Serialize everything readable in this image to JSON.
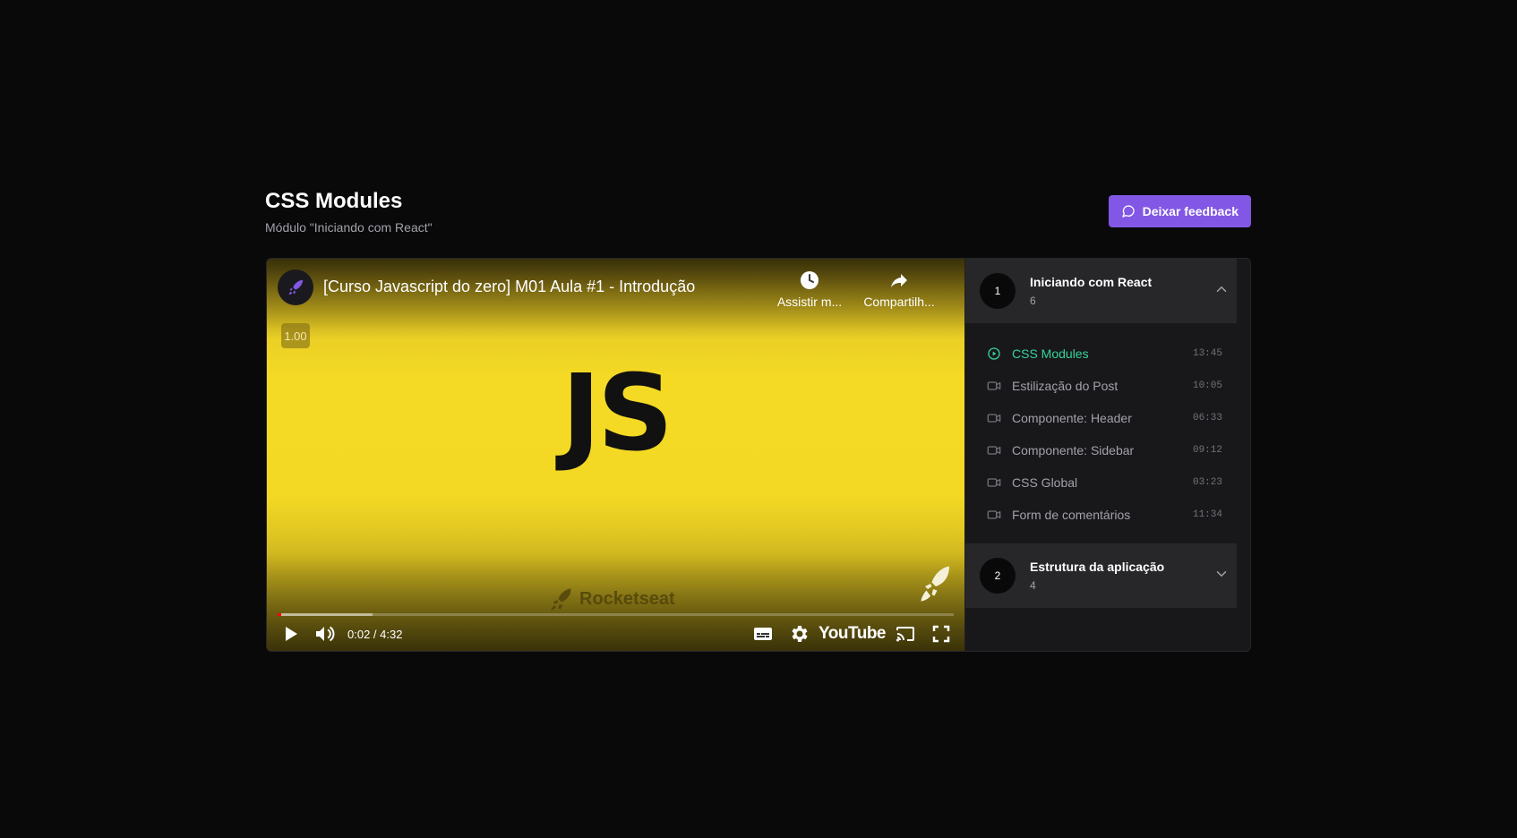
{
  "header": {
    "title": "CSS Modules",
    "subtitle": "Módulo \"Iniciando com React\"",
    "feedback_label": "Deixar feedback"
  },
  "video": {
    "title": "[Curso Javascript do zero] M01 Aula #1 - Introdução",
    "watch_later_label": "Assistir m...",
    "share_label": "Compartilh...",
    "speed": "1.00",
    "logo_text": "JS",
    "brand_text": "Rocketseat",
    "time": "0:02 / 4:32",
    "youtube_label": "YouTube",
    "progress_played_fraction": 0.005,
    "progress_loaded_fraction": 0.14
  },
  "sidebar": {
    "modules": [
      {
        "number": "1",
        "title": "Iniciando com React",
        "count": "6",
        "expanded": true,
        "lessons": [
          {
            "title": "CSS Modules",
            "duration": "13:45",
            "active": true
          },
          {
            "title": "Estilização do Post",
            "duration": "10:05",
            "active": false
          },
          {
            "title": "Componente: Header",
            "duration": "06:33",
            "active": false
          },
          {
            "title": "Componente: Sidebar",
            "duration": "09:12",
            "active": false
          },
          {
            "title": "CSS Global",
            "duration": "03:23",
            "active": false
          },
          {
            "title": "Form de comentários",
            "duration": "11:34",
            "active": false
          }
        ]
      },
      {
        "number": "2",
        "title": "Estrutura da aplicação",
        "count": "4",
        "expanded": false
      }
    ]
  },
  "colors": {
    "accent": "#8257e5",
    "active_lesson": "#34d399",
    "background": "#09090a",
    "panel": "#27272a"
  }
}
